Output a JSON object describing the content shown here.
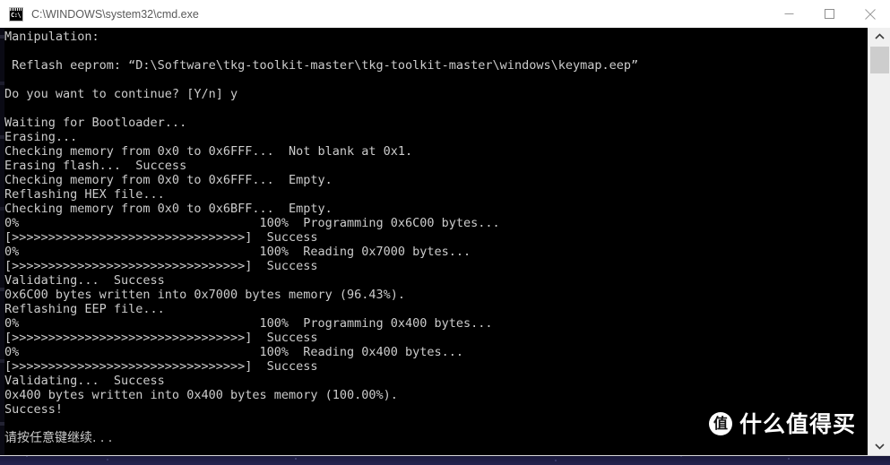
{
  "window": {
    "title": "C:\\WINDOWS\\system32\\cmd.exe",
    "icon": "cmd-console-icon",
    "controls": {
      "minimize": "Minimize",
      "maximize": "Maximize",
      "close": "Close"
    }
  },
  "console": {
    "background_color": "#000000",
    "text_color": "#cccccc",
    "lines": [
      "Manipulation:",
      "",
      " Reflash eeprom: “D:\\Software\\tkg-toolkit-master\\tkg-toolkit-master\\windows\\keymap.eep”",
      "",
      "Do you want to continue? [Y/n] y",
      "",
      "Waiting for Bootloader...",
      "Erasing...",
      "Checking memory from 0x0 to 0x6FFF...  Not blank at 0x1.",
      "Erasing flash...  Success",
      "Checking memory from 0x0 to 0x6FFF...  Empty.",
      "Reflashing HEX file...",
      "Checking memory from 0x0 to 0x6BFF...  Empty.",
      "0%                                 100%  Programming 0x6C00 bytes...",
      "[>>>>>>>>>>>>>>>>>>>>>>>>>>>>>>>>]  Success",
      "0%                                 100%  Reading 0x7000 bytes...",
      "[>>>>>>>>>>>>>>>>>>>>>>>>>>>>>>>>]  Success",
      "Validating...  Success",
      "0x6C00 bytes written into 0x7000 bytes memory (96.43%).",
      "Reflashing EEP file...",
      "0%                                 100%  Programming 0x400 bytes...",
      "[>>>>>>>>>>>>>>>>>>>>>>>>>>>>>>>>]  Success",
      "0%                                 100%  Reading 0x400 bytes...",
      "[>>>>>>>>>>>>>>>>>>>>>>>>>>>>>>>>]  Success",
      "Validating...  Success",
      "0x400 bytes written into 0x400 bytes memory (100.00%).",
      "Success!",
      "",
      "请按任意键继续. . ."
    ]
  },
  "scrollbar": {
    "up_arrow": "∧",
    "down_arrow": "∨",
    "thumb": "scroll-thumb"
  },
  "watermark": {
    "logo_glyph": "值",
    "text": "什么值得买"
  }
}
